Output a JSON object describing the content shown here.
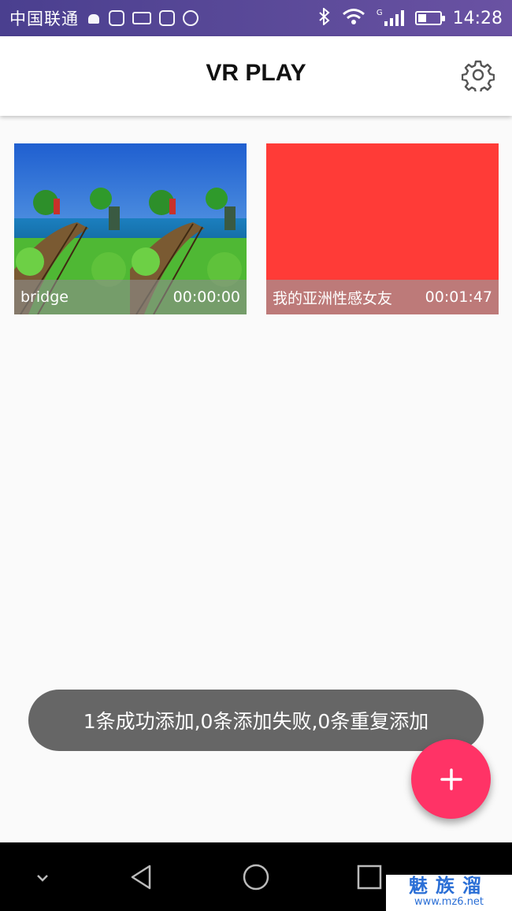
{
  "status_bar": {
    "carrier": "中国联通",
    "network_type": "G",
    "time": "14:28"
  },
  "app_bar": {
    "title": "VR PLAY"
  },
  "videos": [
    {
      "title": "bridge",
      "duration": "00:00:00",
      "thumb": "vr-bridge-scene"
    },
    {
      "title": "我的亚洲性感女友",
      "duration": "00:01:47",
      "thumb_color": "#ff3b37"
    }
  ],
  "toast": {
    "message": "1条成功添加,0条添加失败,0条重复添加"
  },
  "fab": {
    "icon": "plus-icon",
    "color": "#ff3366"
  },
  "watermark": {
    "title": "魅族溜",
    "url": "www.mz6.net"
  }
}
